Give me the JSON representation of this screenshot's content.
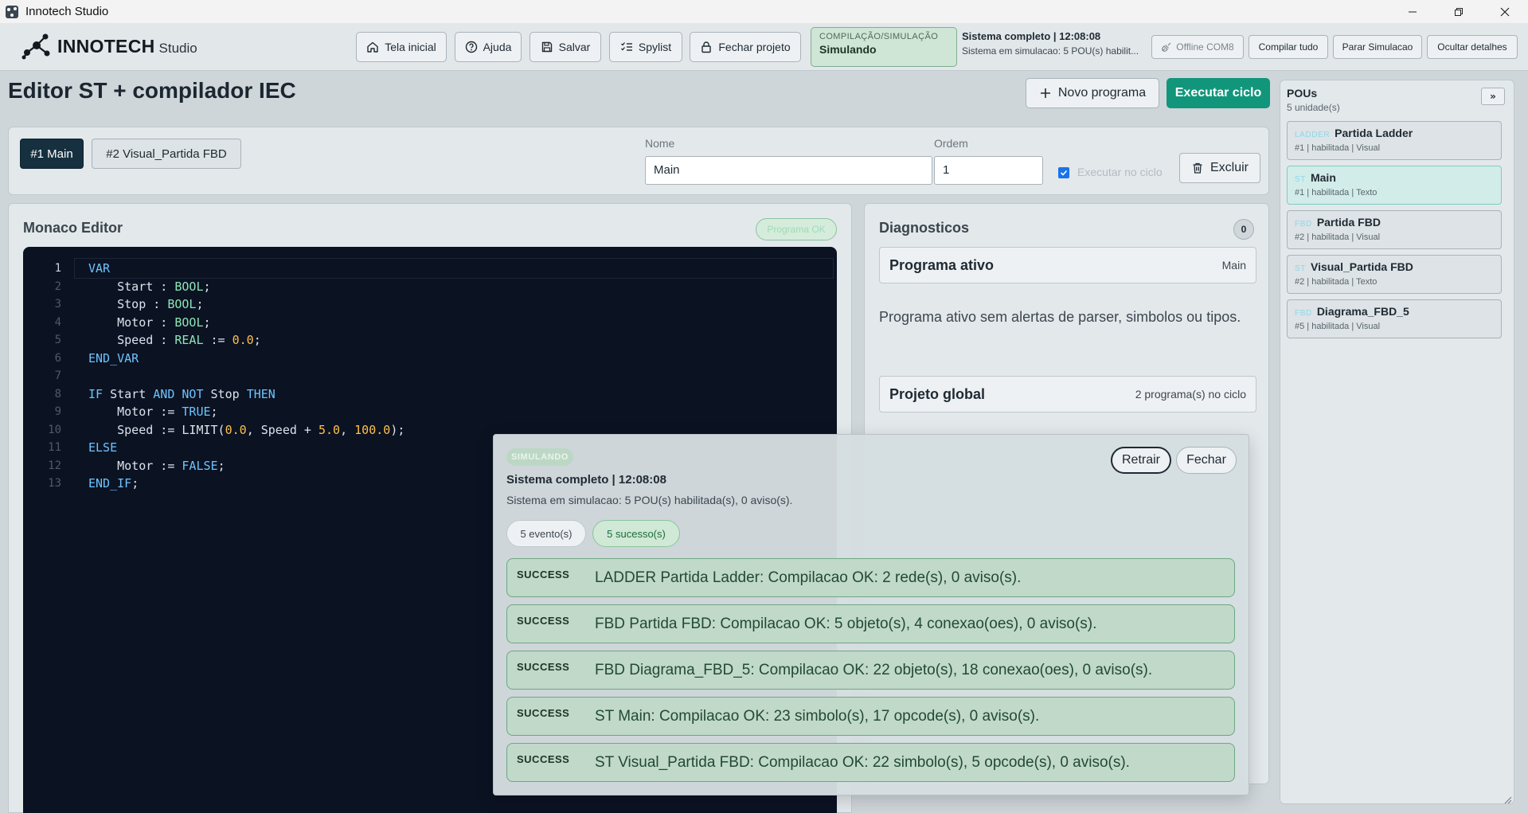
{
  "window": {
    "title": "Innotech Studio"
  },
  "logo": {
    "brand": "INNOTECH",
    "suffix": "Studio"
  },
  "toolbar": {
    "home": "Tela inicial",
    "help": "Ajuda",
    "save": "Salvar",
    "spylist": "Spylist",
    "close_project": "Fechar projeto"
  },
  "status": {
    "label": "COMPILAÇÃO/SIMULAÇÃO",
    "value": "Simulando",
    "summary_title": "Sistema completo | 12:08:08",
    "summary_detail": "Sistema em simulacao: 5 POU(s) habilit..."
  },
  "actions": {
    "offline": "Offline COM8",
    "compile_all": "Compilar tudo",
    "stop_sim": "Parar Simulacao",
    "hide_details": "Ocultar detalhes"
  },
  "page": {
    "title": "Editor ST + compilador IEC",
    "new_program": "Novo programa",
    "run_cycle": "Executar ciclo"
  },
  "programs": {
    "tabs": [
      "#1 Main",
      "#2 Visual_Partida FBD"
    ],
    "name_label": "Nome",
    "name_value": "Main",
    "order_label": "Ordem",
    "order_value": "1",
    "exec_label": "Executar no ciclo",
    "delete": "Excluir"
  },
  "editor": {
    "title": "Monaco Editor",
    "status_badge": "Programa OK",
    "lines": [
      [
        [
          "kw",
          "VAR"
        ]
      ],
      [
        [
          "p",
          "    Start : "
        ],
        [
          "ty",
          "BOOL"
        ],
        [
          "p",
          ";"
        ]
      ],
      [
        [
          "p",
          "    Stop : "
        ],
        [
          "ty",
          "BOOL"
        ],
        [
          "p",
          ";"
        ]
      ],
      [
        [
          "p",
          "    Motor : "
        ],
        [
          "ty",
          "BOOL"
        ],
        [
          "p",
          ";"
        ]
      ],
      [
        [
          "p",
          "    Speed : "
        ],
        [
          "ty",
          "REAL"
        ],
        [
          "p",
          " := "
        ],
        [
          "nm",
          "0.0"
        ],
        [
          "p",
          ";"
        ]
      ],
      [
        [
          "kw",
          "END_VAR"
        ]
      ],
      [],
      [
        [
          "kw",
          "IF"
        ],
        [
          "p",
          " Start "
        ],
        [
          "kw",
          "AND NOT"
        ],
        [
          "p",
          " Stop "
        ],
        [
          "kw",
          "THEN"
        ]
      ],
      [
        [
          "p",
          "    Motor := "
        ],
        [
          "kw",
          "TRUE"
        ],
        [
          "p",
          ";"
        ]
      ],
      [
        [
          "p",
          "    Speed := LIMIT("
        ],
        [
          "nm",
          "0.0"
        ],
        [
          "p",
          ", Speed + "
        ],
        [
          "nm",
          "5.0"
        ],
        [
          "p",
          ", "
        ],
        [
          "nm",
          "100.0"
        ],
        [
          "p",
          ");"
        ]
      ],
      [
        [
          "kw",
          "ELSE"
        ]
      ],
      [
        [
          "p",
          "    Motor := "
        ],
        [
          "kw",
          "FALSE"
        ],
        [
          "p",
          ";"
        ]
      ],
      [
        [
          "kw",
          "END_IF"
        ],
        [
          "p",
          ";"
        ]
      ]
    ]
  },
  "diagnostics": {
    "title": "Diagnosticos",
    "count": "0",
    "active_label": "Programa ativo",
    "active_value": "Main",
    "message": "Programa ativo sem alertas de parser, simbolos ou tipos.",
    "global_label": "Projeto global",
    "global_value": "2 programa(s) no ciclo"
  },
  "pous": {
    "title": "POUs",
    "subtitle": "5 unidade(s)",
    "collapse": "»",
    "items": [
      {
        "tag": "LADDER",
        "name": "Partida Ladder",
        "meta": "#1 | habilitada | Visual"
      },
      {
        "tag": "ST",
        "name": "Main",
        "meta": "#1 | habilitada | Texto"
      },
      {
        "tag": "FBD",
        "name": "Partida FBD",
        "meta": "#2 | habilitada | Visual"
      },
      {
        "tag": "ST",
        "name": "Visual_Partida FBD",
        "meta": "#2 | habilitada | Texto"
      },
      {
        "tag": "FBD",
        "name": "Diagrama_FBD_5",
        "meta": "#5 | habilitada | Visual"
      }
    ]
  },
  "simulation": {
    "badge": "SIMULANDO",
    "title": "Sistema completo | 12:08:08",
    "description": "Sistema em simulacao: 5 POU(s) habilitada(s), 0 aviso(s).",
    "events_chip": "5 evento(s)",
    "success_chip": "5 sucesso(s)",
    "retract": "Retrair",
    "close": "Fechar",
    "logs": [
      {
        "level": "SUCCESS",
        "message": "LADDER Partida Ladder: Compilacao OK: 2 rede(s), 0 aviso(s)."
      },
      {
        "level": "SUCCESS",
        "message": "FBD Partida FBD: Compilacao OK: 5 objeto(s), 4 conexao(oes), 0 aviso(s)."
      },
      {
        "level": "SUCCESS",
        "message": "FBD Diagrama_FBD_5: Compilacao OK: 22 objeto(s), 18 conexao(oes), 0 aviso(s)."
      },
      {
        "level": "SUCCESS",
        "message": "ST Main: Compilacao OK: 23 simbolo(s), 17 opcode(s), 0 aviso(s)."
      },
      {
        "level": "SUCCESS",
        "message": "ST Visual_Partida FBD: Compilacao OK: 22 simbolo(s), 5 opcode(s), 0 aviso(s)."
      }
    ]
  }
}
